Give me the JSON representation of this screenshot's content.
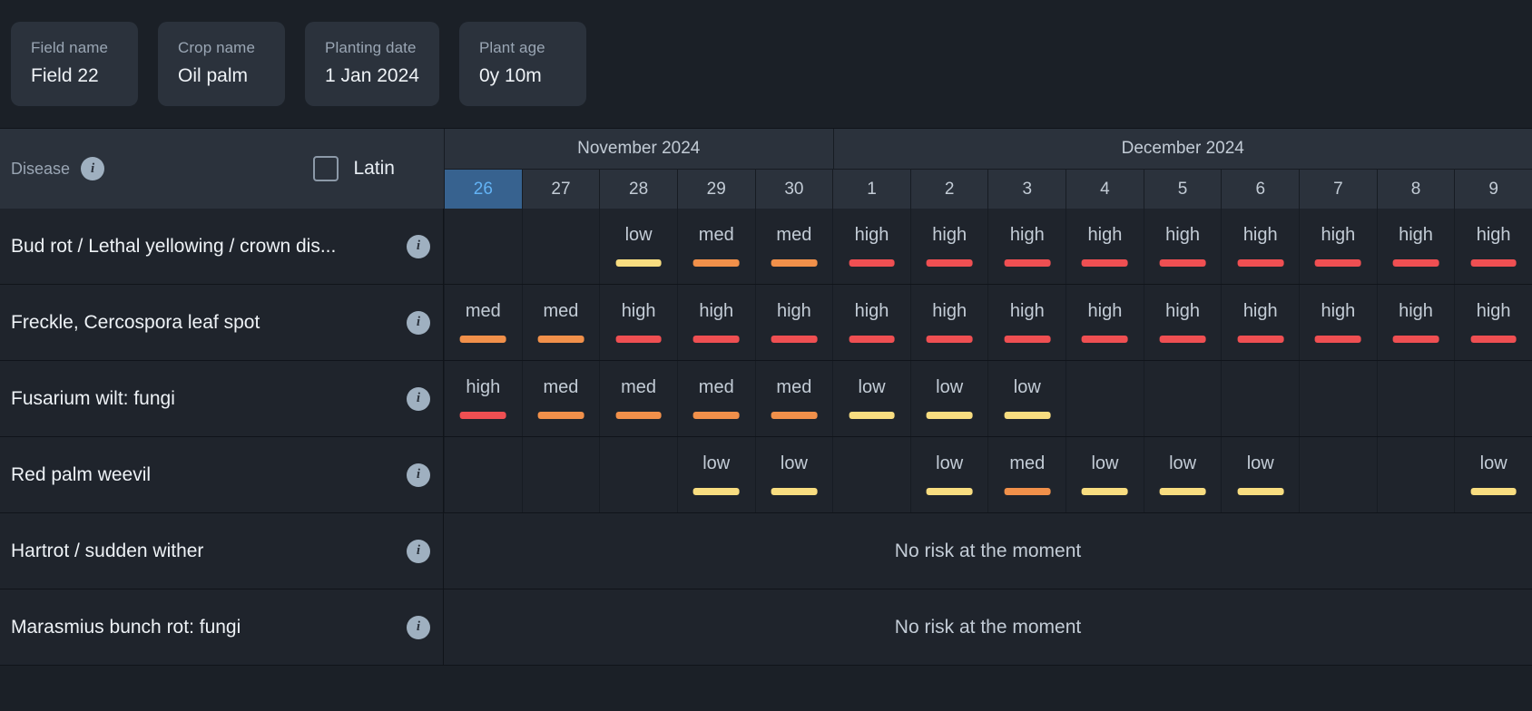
{
  "summary": {
    "cards": [
      {
        "label": "Field name",
        "value": "Field 22"
      },
      {
        "label": "Crop name",
        "value": "Oil palm"
      },
      {
        "label": "Planting date",
        "value": "1 Jan 2024"
      },
      {
        "label": "Plant age",
        "value": "0y 10m"
      }
    ]
  },
  "table": {
    "disease_header": "Disease",
    "disease_info_icon": "info-icon",
    "latin_label": "Latin",
    "latin_checked": false,
    "no_risk_text": "No risk at the moment",
    "months": [
      {
        "label": "November 2024",
        "span": 5
      },
      {
        "label": "December 2024",
        "span": 9
      }
    ],
    "days": [
      {
        "label": "26",
        "today": true
      },
      {
        "label": "27",
        "today": false
      },
      {
        "label": "28",
        "today": false
      },
      {
        "label": "29",
        "today": false
      },
      {
        "label": "30",
        "today": false
      },
      {
        "label": "1",
        "today": false
      },
      {
        "label": "2",
        "today": false
      },
      {
        "label": "3",
        "today": false
      },
      {
        "label": "4",
        "today": false
      },
      {
        "label": "5",
        "today": false
      },
      {
        "label": "6",
        "today": false
      },
      {
        "label": "7",
        "today": false
      },
      {
        "label": "8",
        "today": false
      },
      {
        "label": "9",
        "today": false
      }
    ],
    "risk_colors": {
      "low": "#f8dd80",
      "med": "#f1904a",
      "high": "#ef4f52"
    },
    "rows": [
      {
        "name": "Bud rot / Lethal yellowing / crown dis...",
        "no_risk": false,
        "cells": [
          "",
          "",
          "low",
          "med",
          "med",
          "high",
          "high",
          "high",
          "high",
          "high",
          "high",
          "high",
          "high",
          "high"
        ]
      },
      {
        "name": "Freckle, Cercospora leaf spot",
        "no_risk": false,
        "cells": [
          "med",
          "med",
          "high",
          "high",
          "high",
          "high",
          "high",
          "high",
          "high",
          "high",
          "high",
          "high",
          "high",
          "high"
        ]
      },
      {
        "name": "Fusarium wilt: fungi",
        "no_risk": false,
        "cells": [
          "high",
          "med",
          "med",
          "med",
          "med",
          "low",
          "low",
          "low",
          "",
          "",
          "",
          "",
          "",
          ""
        ]
      },
      {
        "name": "Red palm weevil",
        "no_risk": false,
        "cells": [
          "",
          "",
          "",
          "low",
          "low",
          "",
          "low",
          "med",
          "low",
          "low",
          "low",
          "",
          "",
          "low"
        ]
      },
      {
        "name": "Hartrot / sudden wither",
        "no_risk": true,
        "cells": []
      },
      {
        "name": "Marasmius bunch rot: fungi",
        "no_risk": true,
        "cells": []
      }
    ]
  }
}
